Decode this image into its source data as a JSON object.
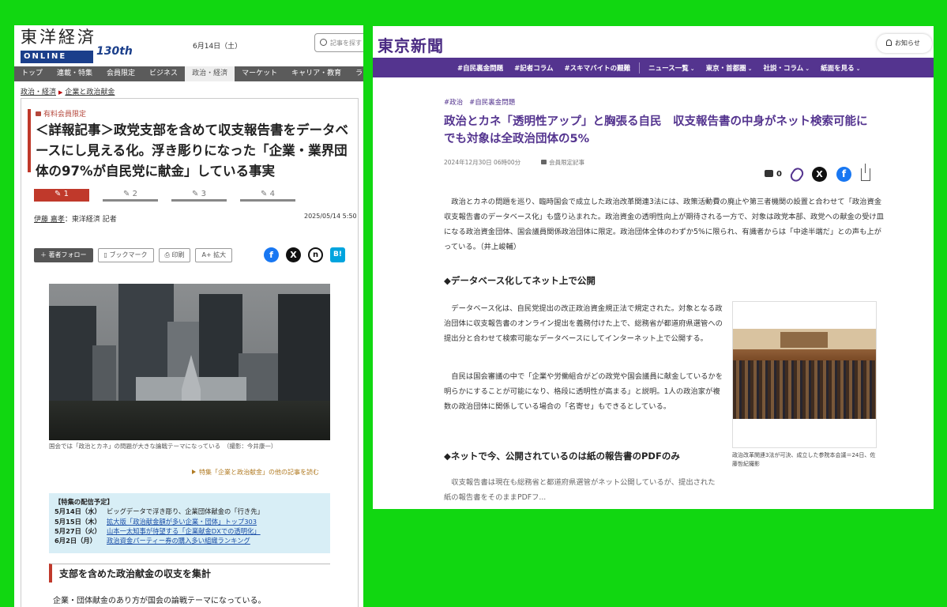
{
  "left": {
    "logo": {
      "jp": "東洋経済",
      "en": "ONLINE",
      "years": "130th"
    },
    "date": "6月14日（土）",
    "search_placeholder": "記事を探す",
    "nav": [
      "トップ",
      "連載・特集",
      "会員限定",
      "ビジネス",
      "政治・経済",
      "マーケット",
      "キャリア・教育",
      "ライフ"
    ],
    "nav_active_index": 4,
    "breadcrumb": [
      "政治・経済",
      "企業と政治献金"
    ],
    "member_label": "有料会員限定",
    "title": "＜詳報記事＞政党支部を含めて収支報告書をデータベースにし見える化。浮き彫りになった「企業・業界団体の97%が自民党に献金」している事実",
    "pages": [
      "1",
      "2",
      "3",
      "4"
    ],
    "author_name": "伊藤 嘉孝",
    "author_org": "：東洋経済 記者",
    "pub_date": "2025/05/14 5:50",
    "tools": {
      "follow": "著者フォロー",
      "bookmark": "ブックマーク",
      "print": "印刷",
      "zoom": "拡大"
    },
    "social": {
      "fb": "f",
      "x": "X",
      "note": "n",
      "hatena": "B!"
    },
    "photo_caption": "国会では「政治とカネ」の問題が大きな論戦テーマになっている　（撮影：今井康一）",
    "related_link": "特集「企業と政治献金」の他の記事を読む",
    "schedule": {
      "header": "【特集の配信予定】",
      "rows": [
        {
          "date": "5月14日（水）",
          "text": "ビッグデータで浮き彫り、企業団体献金の「行き先」",
          "link": false
        },
        {
          "date": "5月15日（木）",
          "text": "拡大版「政治献金額が多い企業・団体」トップ303",
          "link": true
        },
        {
          "date": "5月27日（火）",
          "text": "山本一太知事が待望する「企業献金DXでの透明化」",
          "link": true
        },
        {
          "date": "6月2日（月）",
          "text": "政治資金パーティー券の購入多い組織ランキング",
          "link": true
        }
      ]
    },
    "section_heading": "支部を含めた政治献金の収支を集計",
    "body_text": "企業・団体献金のあり方が国会の論戦テーマになっている。"
  },
  "right": {
    "logo": "東京新聞",
    "notify": "お知らせ",
    "nav": [
      "#自民裏金問題",
      "#記者コラム",
      "#スキマバイトの艱難",
      "ニュース一覧",
      "東京・首都圏",
      "社説・コラム",
      "紙面を見る"
    ],
    "tags": [
      "#政治",
      "#自民裏金問題"
    ],
    "title": "政治とカネ「透明性アップ」と胸張る自民　収支報告書の中身がネット検索可能に　でも対象は全政治団体の5%",
    "date": "2024年12月30日 06時00分",
    "member_label": "会員限定記事",
    "comment_count": "0",
    "lead": "　政治とカネの問題を巡り、臨時国会で成立した政治改革関連3法には、政策活動費の廃止や第三者機関の設置と合わせて「政治資金収支報告書のデータベース化」も盛り込まれた。政治資金の透明性向上が期待される一方で、対象は政党本部、政党への献金の受け皿になる政治資金団体、国会議員関係政治団体に限定。政治団体全体のわずか5%に限られ、有識者からは「中途半端だ」との声も上がっている。（井上峻輔）",
    "h1": "◆データベース化してネット上で公開",
    "p1": "　データベース化は、自民党提出の改正政治資金規正法で規定された。対象となる政治団体に収支報告書のオンライン提出を義務付けた上で、総務省が都道府県選管への提出分と合わせて検索可能なデータベースにしてインターネット上で公開する。",
    "p2": "　自民は国会審議の中で「企業や労働組合がどの政党や国会議員に献金しているかを明らかにすることが可能になり、格段に透明性が高まる」と説明。1人の政治家が複数の政治団体に関係している場合の「名寄せ」もできるとしている。",
    "h2": "◆ネットで今、公開されているのは紙の報告書のPDFのみ",
    "p3": "　収支報告書は現在も総務省と都道府県選管がネット公開しているが、提出された紙の報告書をそのままPDFフ...",
    "photo_caption": "政治改革関連3法が可決、成立した参院本会議＝24日、佐藤哲紀撮影"
  }
}
